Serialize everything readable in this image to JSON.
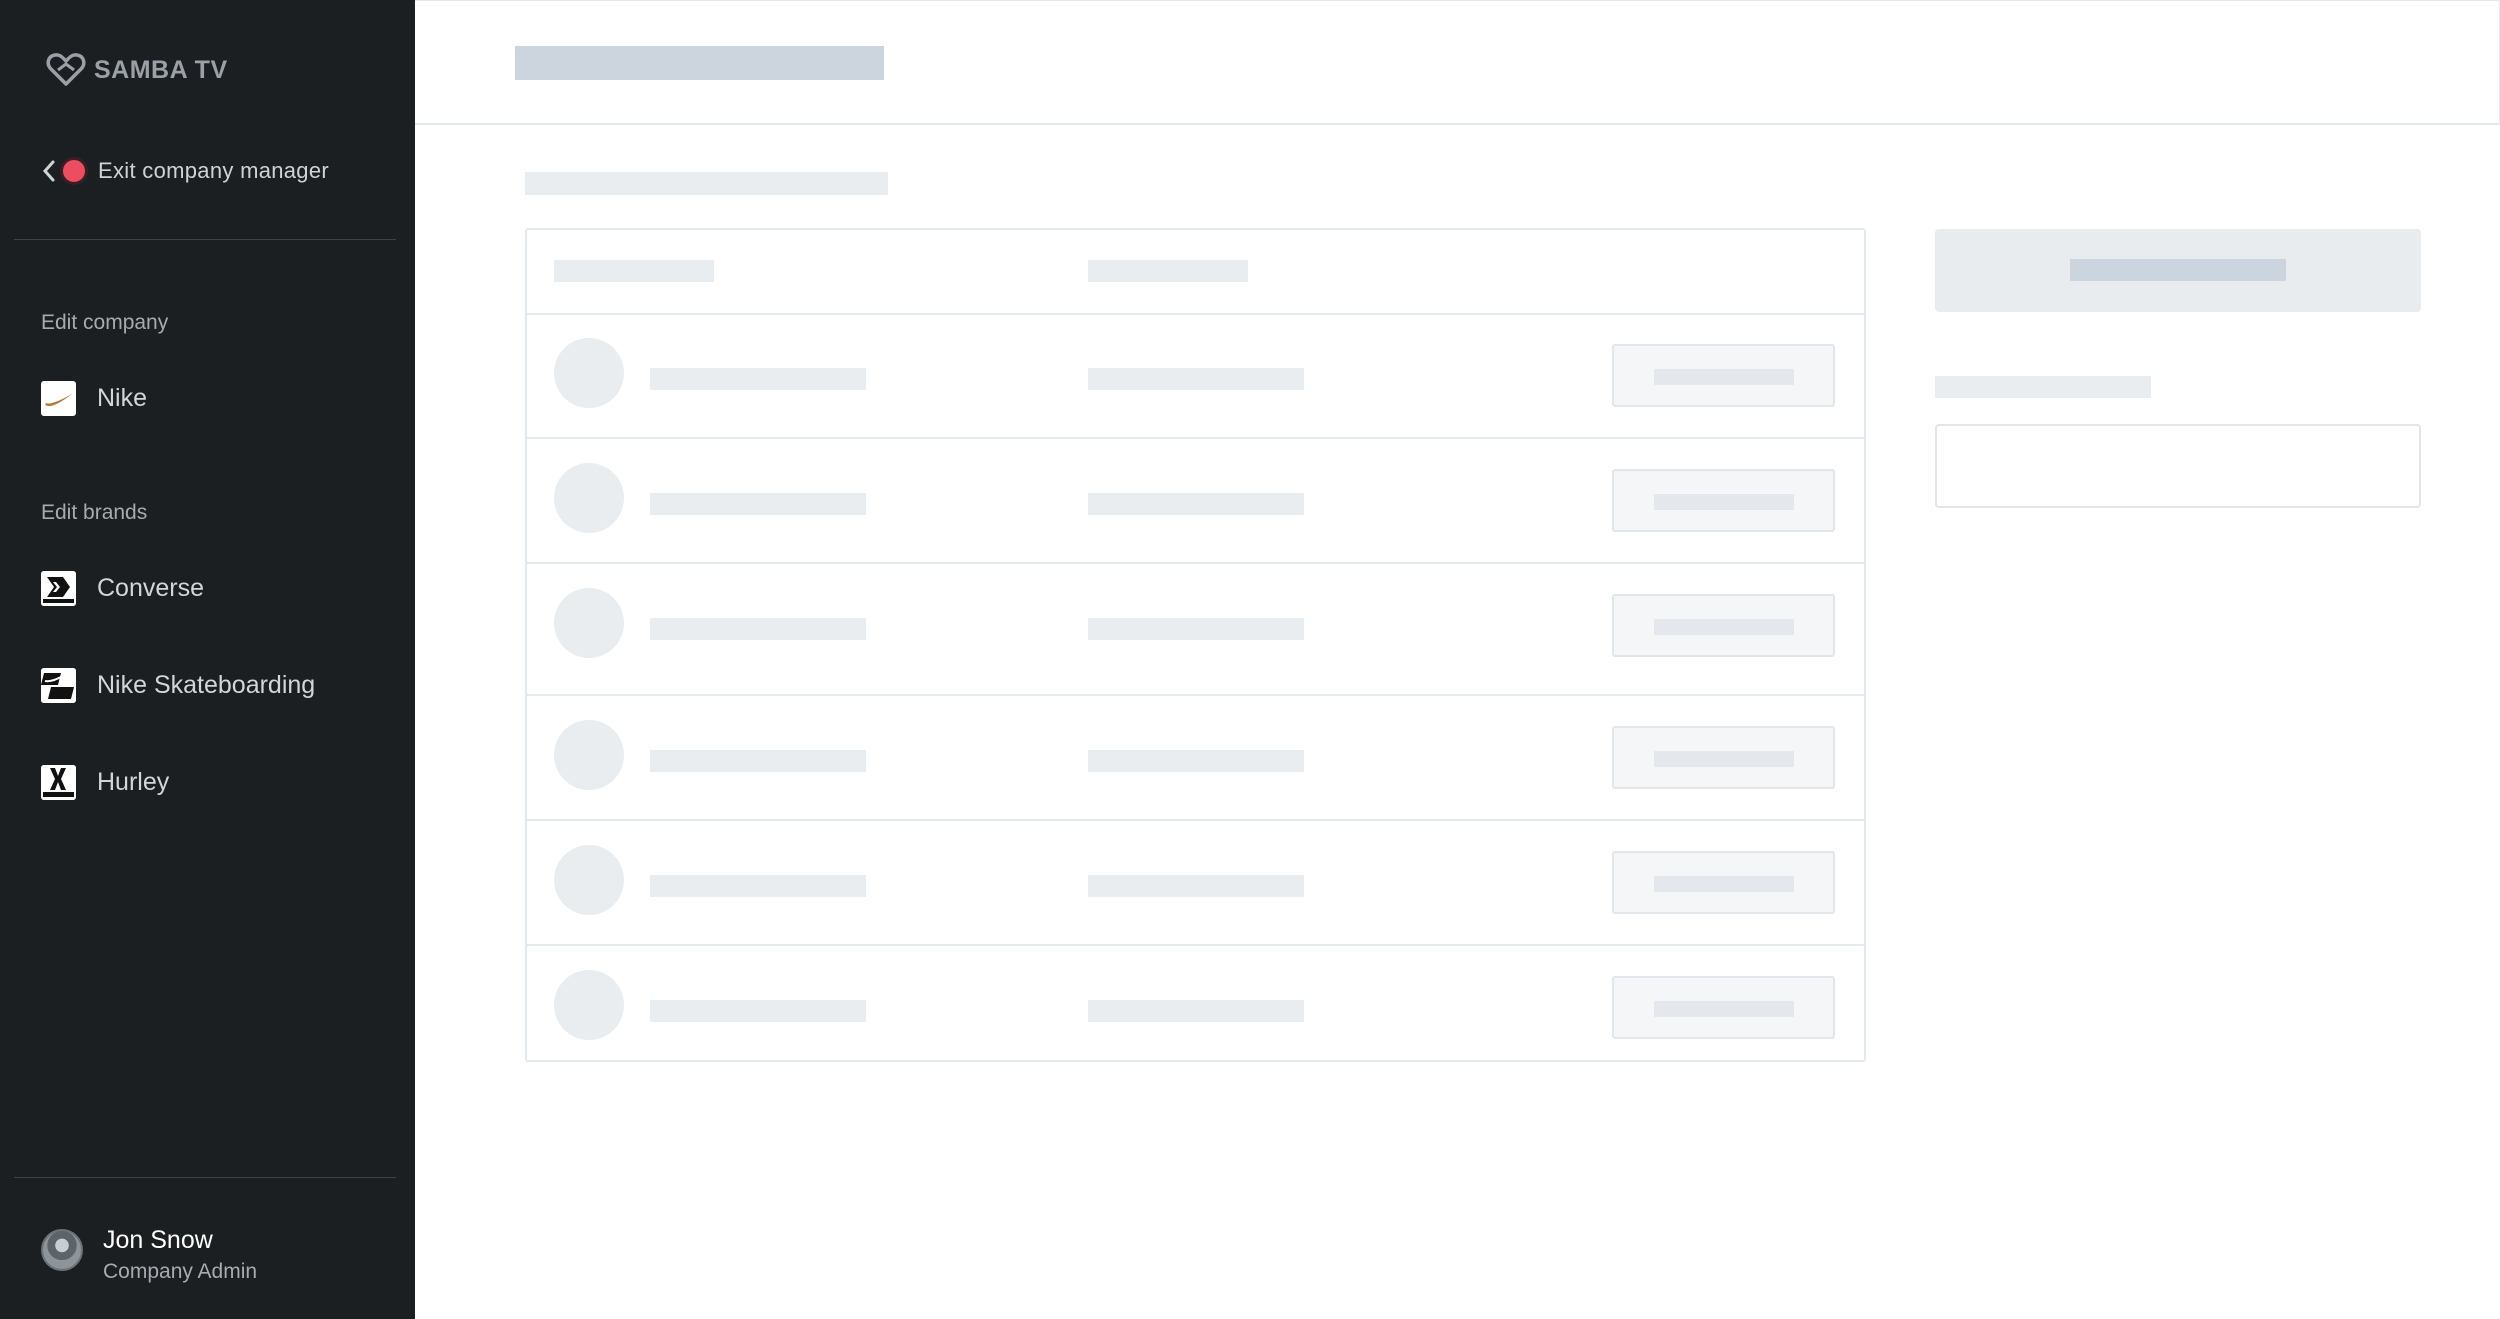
{
  "app": {
    "brand_name": "SAMBA TV",
    "exit_label": "Exit company manager"
  },
  "sidebar": {
    "company_section_label": "Edit company",
    "company": {
      "name": "Nike",
      "icon": "nike-swoosh-icon"
    },
    "brands_section_label": "Edit brands",
    "brands": [
      {
        "name": "Converse",
        "icon": "converse-logo-icon"
      },
      {
        "name": "Nike Skateboarding",
        "icon": "nike-sb-logo-icon"
      },
      {
        "name": "Hurley",
        "icon": "hurley-logo-icon"
      }
    ]
  },
  "user": {
    "name": "Jon Snow",
    "role": "Company Admin"
  },
  "colors": {
    "sidebar_bg": "#1b1f22",
    "status_dot": "#ec4d61",
    "skeleton": "#e9edf0",
    "skeleton_dark": "#ccd5de"
  },
  "loading_state": {
    "table_rows": 6
  }
}
